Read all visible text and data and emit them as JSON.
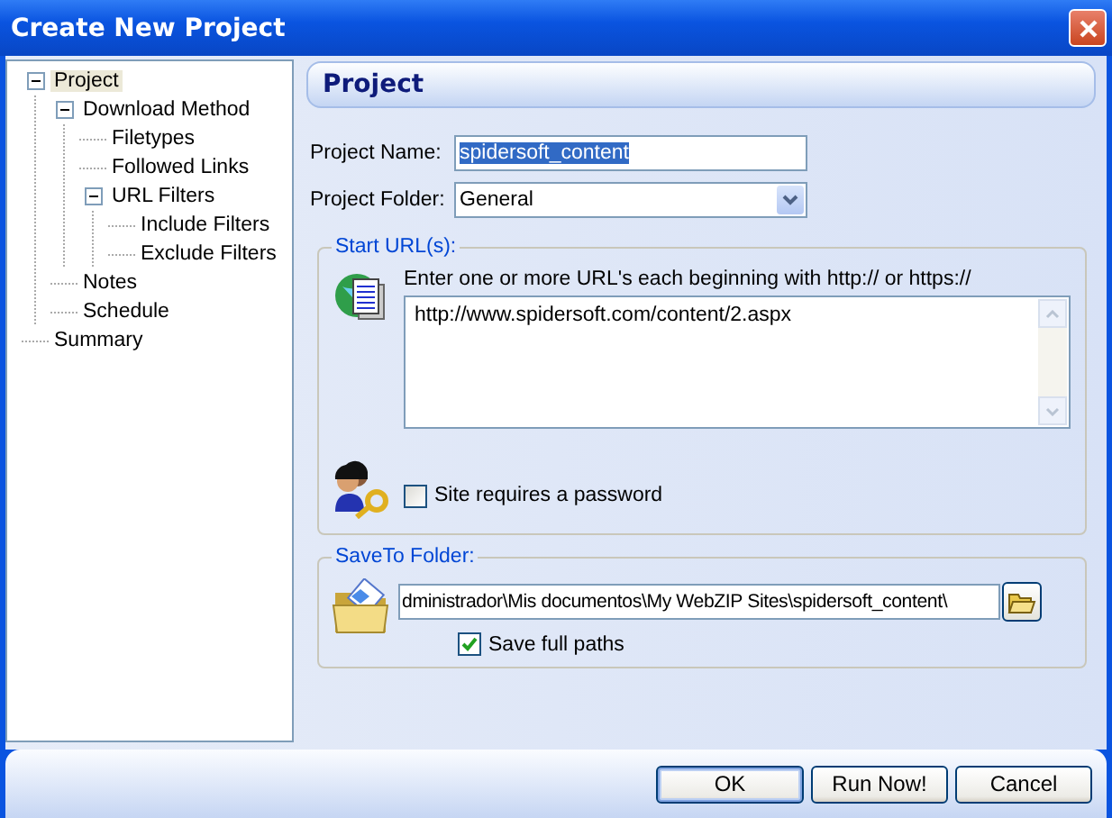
{
  "window": {
    "title": "Create New Project"
  },
  "tree": [
    {
      "label": "Project",
      "selected": true,
      "expanded": true,
      "children": [
        {
          "label": "Download Method",
          "selected": false,
          "expanded": true,
          "children": [
            {
              "label": "Filetypes",
              "selected": false
            },
            {
              "label": "Followed Links",
              "selected": false
            },
            {
              "label": "URL Filters",
              "selected": false,
              "expanded": true,
              "children": [
                {
                  "label": "Include Filters",
                  "selected": false
                },
                {
                  "label": "Exclude Filters",
                  "selected": false
                }
              ]
            }
          ]
        },
        {
          "label": "Notes",
          "selected": false
        },
        {
          "label": "Schedule",
          "selected": false
        }
      ]
    },
    {
      "label": "Summary",
      "selected": false
    }
  ],
  "header": "Project",
  "fields": [
    {
      "label": "Project Name:",
      "kind": "text",
      "value": "spidersoft_content",
      "highlighted": true
    },
    {
      "label": "Project Folder:",
      "kind": "dropdown",
      "value": "General",
      "highlighted": false
    }
  ],
  "start_urls": {
    "legend": "Start URL(s):",
    "instruction": "Enter one or more URL's each beginning with http:// or https://",
    "urls": "http://www.spidersoft.com/content/2.aspx",
    "password": {
      "label": "Site requires a password",
      "checked": false
    }
  },
  "save_to": {
    "legend": "SaveTo Folder:",
    "path": "dministrador\\Mis documentos\\My WebZIP Sites\\spidersoft_content\\",
    "full_paths": {
      "label": "Save full paths",
      "checked": true
    }
  },
  "buttons": [
    {
      "label": "OK",
      "default": true
    },
    {
      "label": "Run Now!",
      "default": false
    },
    {
      "label": "Cancel",
      "default": false
    }
  ]
}
